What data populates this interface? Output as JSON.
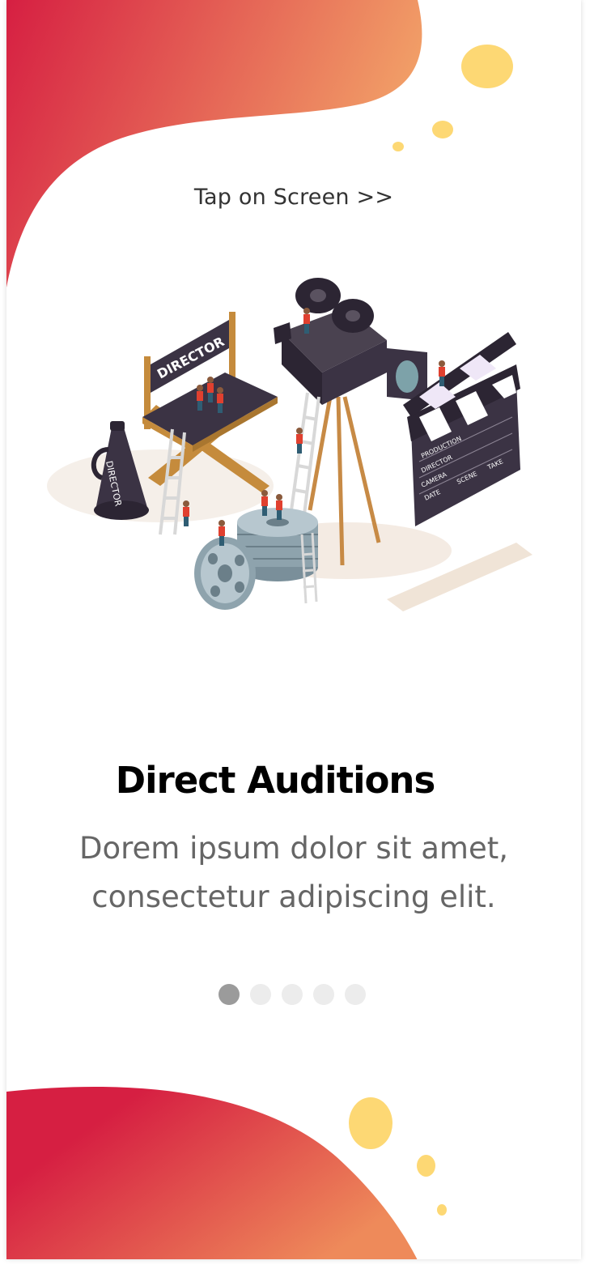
{
  "screen": {
    "tap_hint": "Tap on Screen >>",
    "title": "Direct Auditions",
    "description_line1": "Dorem ipsum dolor sit amet,",
    "description_line2": "consectetur adipiscing elit."
  },
  "illustration": {
    "chair_label": "DIRECTOR",
    "megaphone_label": "DIRECTOR",
    "clapper_rows": [
      "PRODUCTION",
      "DIRECTOR",
      "CAMERA",
      "DATE",
      "SCENE",
      "TAKE"
    ]
  },
  "pager": {
    "count": 5,
    "active_index": 0
  },
  "colors": {
    "gradient_start": "#d61f42",
    "gradient_end": "#f2a268",
    "accent_yellow": "#fdd874",
    "dot_active": "#9b9b9b",
    "dot_inactive": "#ececec"
  }
}
